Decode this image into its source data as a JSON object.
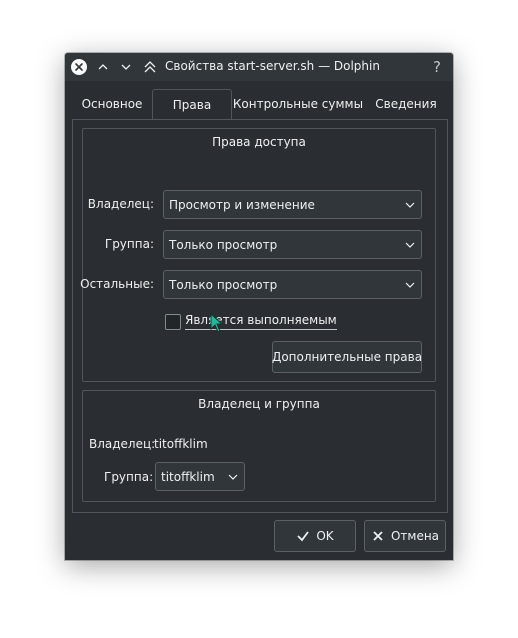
{
  "window": {
    "title": "Свойства start-server.sh — Dolphin",
    "help_glyph": "?"
  },
  "tabs": [
    {
      "label": "Основное",
      "active": false
    },
    {
      "label": "Права",
      "active": true
    },
    {
      "label": "Контрольные суммы",
      "active": false
    },
    {
      "label": "Сведения",
      "active": false
    }
  ],
  "permissions": {
    "title": "Права доступа",
    "owner_label": "Владелец:",
    "owner_value": "Просмотр и изменение",
    "group_label": "Группа:",
    "group_value": "Только просмотр",
    "others_label": "Остальные:",
    "others_value": "Только просмотр",
    "executable_label": "Является выполняемым",
    "executable_checked": false,
    "advanced_button": "Дополнительные права"
  },
  "ownership": {
    "title": "Владелец и группа",
    "owner_label": "Владелец:",
    "owner_value": "titoffklim",
    "group_label": "Группа:",
    "group_value": "titoffklim"
  },
  "buttons": {
    "ok": "OK",
    "cancel": "Отмена"
  },
  "colors": {
    "window_bg": "#2a2e32",
    "accent_cursor": "#1abc9c",
    "text": "#eff0f1"
  }
}
